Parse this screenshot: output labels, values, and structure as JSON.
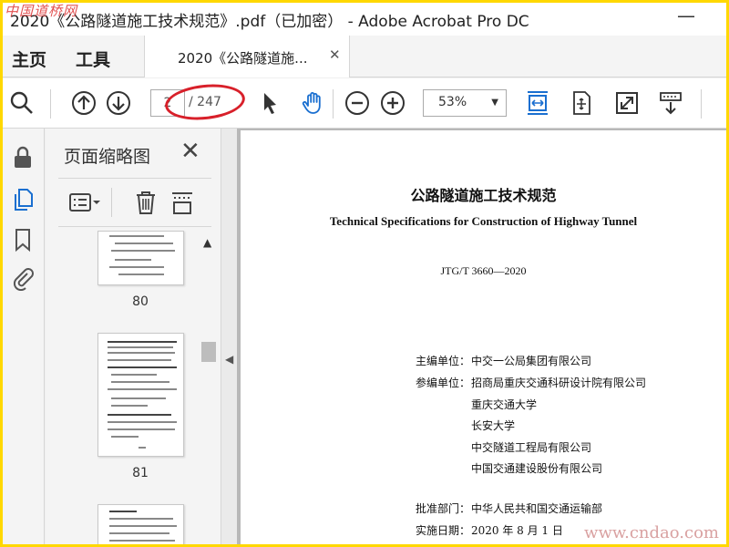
{
  "window": {
    "title": "2020《公路隧道施工技术规范》.pdf（已加密） - Adobe Acrobat Pro DC",
    "minimize_glyph": "—",
    "watermark_top": "中国道桥网"
  },
  "menu": {
    "home": "主页",
    "tools": "工具"
  },
  "tab": {
    "label": "2020《公路隧道施...",
    "close_glyph": "✕"
  },
  "toolbar": {
    "page_current": "2",
    "page_total": "/ 247",
    "zoom": "53%",
    "icons": [
      "search-icon",
      "page-up-icon",
      "page-down-icon",
      "select-arrow-icon",
      "hand-icon",
      "zoom-out-icon",
      "zoom-in-icon",
      "fit-width-icon",
      "fit-page-icon",
      "fullscreen-icon",
      "scroll-mode-icon"
    ]
  },
  "nav_rail": {
    "icons": [
      "lock-icon",
      "pages-icon",
      "bookmark-icon",
      "attachment-icon"
    ]
  },
  "thumbnail_panel": {
    "title": "页面缩略图",
    "close_glyph": "✕",
    "thumbnails": [
      {
        "label": "80"
      },
      {
        "label": "81"
      },
      {
        "label": ""
      }
    ]
  },
  "document": {
    "title_cn": "公路隧道施工技术规范",
    "title_en": "Technical Specifications for Construction of Highway Tunnel",
    "code": "JTG/T 3660—2020",
    "editor_label": "主编单位：",
    "editor": "中交一公局集团有限公司",
    "participants_label": "参编单位：",
    "participants": [
      "招商局重庆交通科研设计院有限公司",
      "重庆交通大学",
      "长安大学",
      "中交隧道工程局有限公司",
      "中国交通建设股份有限公司"
    ],
    "approver_label": "批准部门：",
    "approver": "中华人民共和国交通运输部",
    "date_label": "实施日期：",
    "date": "2020 年 8 月 1 日"
  },
  "watermark_bottom": "www.cndao.com",
  "colors": {
    "accent": "#1a6fd0",
    "annotation": "#d8202a",
    "border": "#ffd800"
  }
}
